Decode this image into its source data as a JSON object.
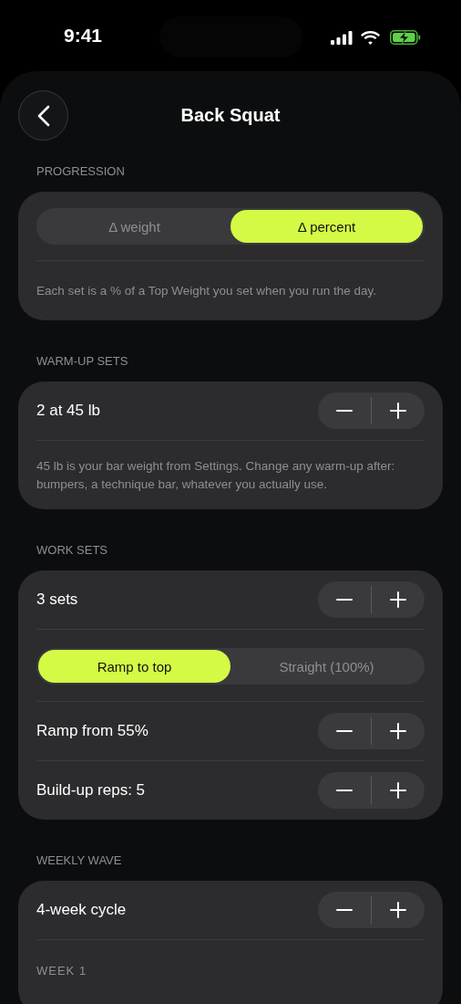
{
  "status_bar": {
    "time": "9:41"
  },
  "header": {
    "title": "Back Squat"
  },
  "sections": [
    {
      "label": "PROGRESSION",
      "items": [
        {
          "kind": "segmented",
          "options": [
            {
              "label": "Δ weight",
              "selected": false
            },
            {
              "label": "Δ percent",
              "selected": true
            }
          ]
        },
        {
          "kind": "note",
          "text": "Each set is a % of a Top Weight you set when you run the day."
        }
      ]
    },
    {
      "label": "WARM-UP SETS",
      "items": [
        {
          "kind": "stepper",
          "label": "2 at 45 lb"
        },
        {
          "kind": "note",
          "text": "45 lb is your bar weight from Settings. Change any warm-up after: bumpers, a technique bar, whatever you actually use."
        }
      ]
    },
    {
      "label": "WORK SETS",
      "items": [
        {
          "kind": "stepper",
          "label": "3 sets"
        },
        {
          "kind": "segmented",
          "options": [
            {
              "label": "Ramp to top",
              "selected": true
            },
            {
              "label": "Straight (100%)",
              "selected": false
            }
          ]
        },
        {
          "kind": "stepper",
          "label": "Ramp from 55%"
        },
        {
          "kind": "stepper",
          "label": "Build-up reps: 5"
        }
      ]
    },
    {
      "label": "WEEKLY WAVE",
      "items": [
        {
          "kind": "stepper",
          "label": "4-week cycle"
        },
        {
          "kind": "subheading",
          "label": "WEEK 1"
        }
      ]
    }
  ]
}
